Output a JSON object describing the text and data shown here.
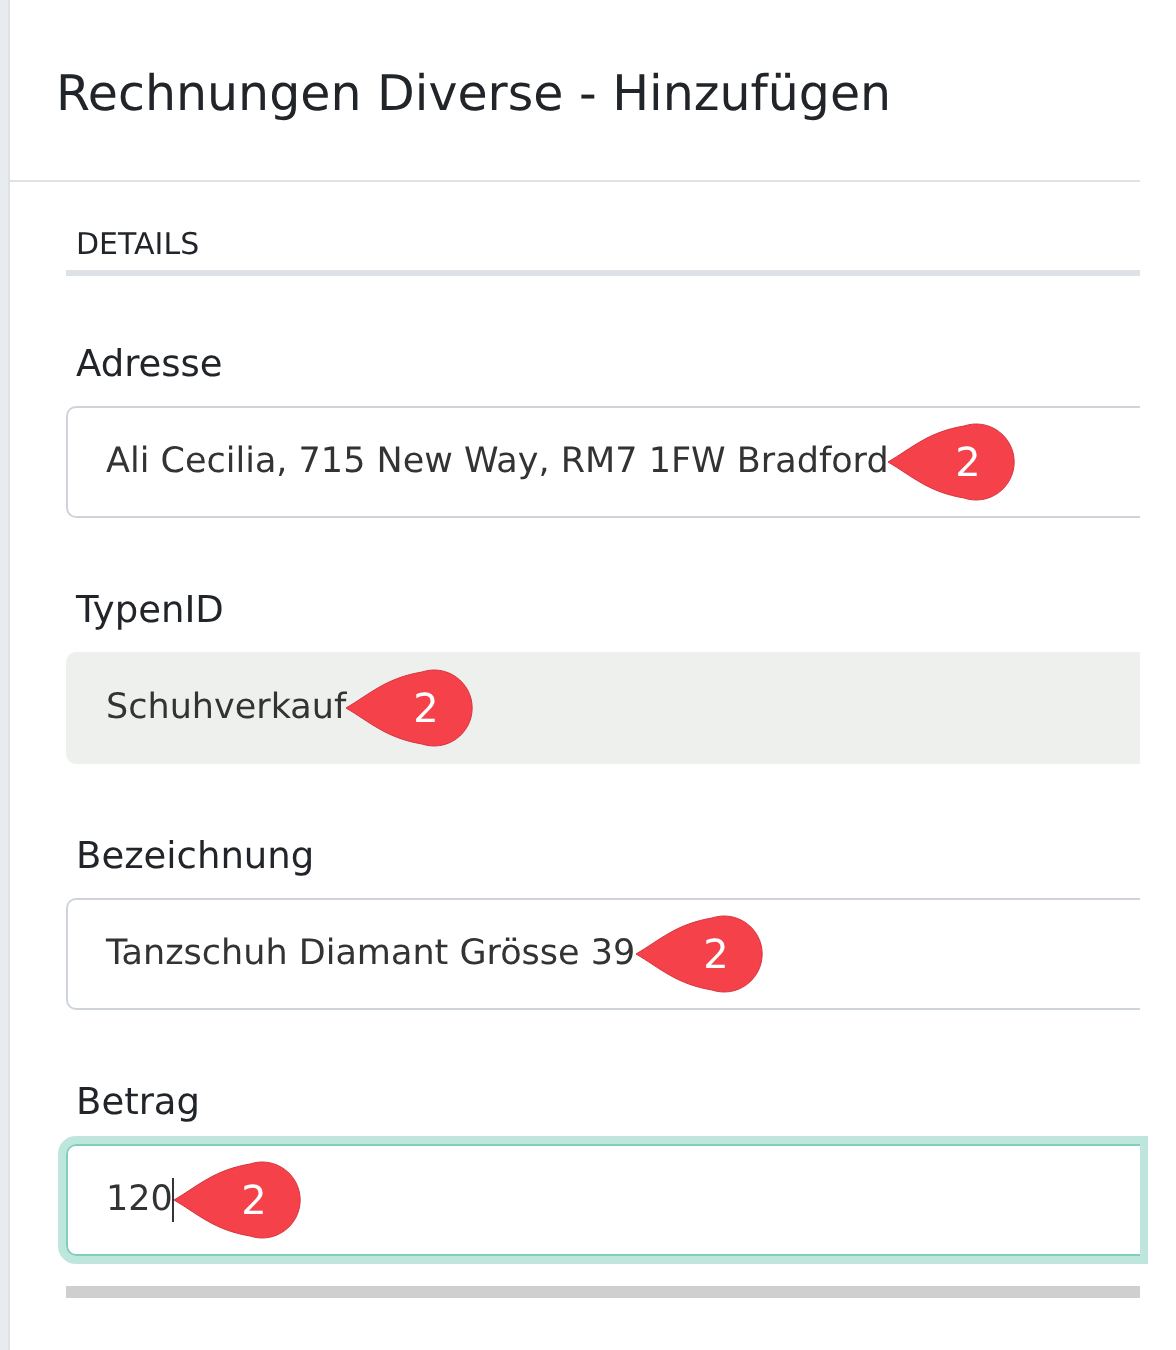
{
  "dialog": {
    "title": "Rechnungen Diverse - Hinzufügen"
  },
  "section": {
    "title": "DETAILS"
  },
  "fields": [
    {
      "label": "Adresse",
      "value": "Ali Cecilia, 715 New Way, RM7 1FW Bradford",
      "disabled": false,
      "focused": false,
      "callout": "2"
    },
    {
      "label": "TypenID",
      "value": "Schuhverkauf",
      "disabled": true,
      "focused": false,
      "callout": "2"
    },
    {
      "label": "Bezeichnung",
      "value": "Tanzschuh Diamant Grösse 39",
      "disabled": false,
      "focused": false,
      "callout": "2"
    },
    {
      "label": "Betrag",
      "value": "120",
      "disabled": false,
      "focused": true,
      "callout": "2"
    }
  ]
}
